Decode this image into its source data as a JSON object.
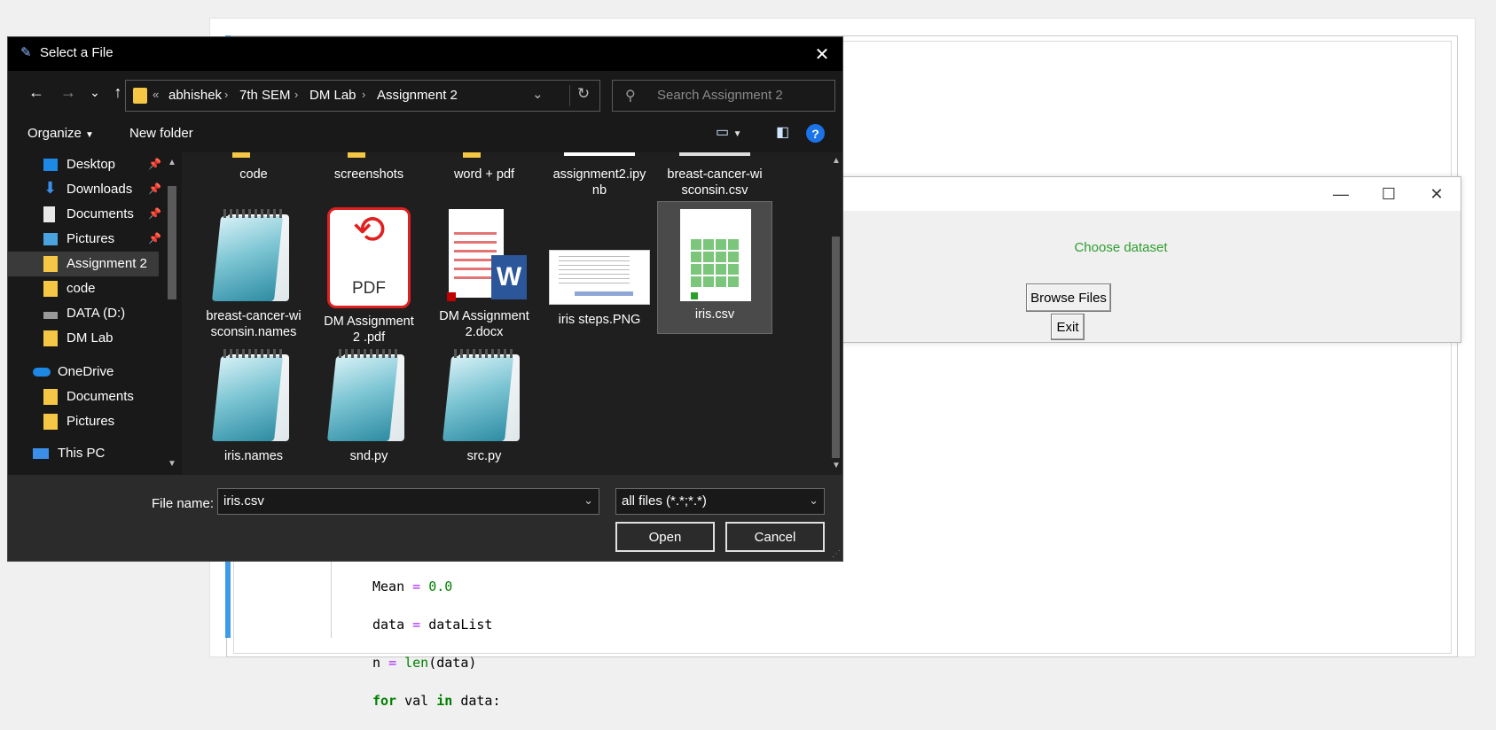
{
  "editor": {
    "code_lines": [
      {
        "a": "Mean ",
        "op": "=",
        "b": " ",
        "num": "0.0"
      },
      {
        "a": "data ",
        "op": "=",
        "b": " dataList"
      },
      {
        "a": "n ",
        "op": "=",
        "b": " ",
        "fn": "len",
        "c": "(data)"
      },
      {
        "kw1": "for",
        "a": " val ",
        "kw2": "in",
        "b": " data:"
      }
    ]
  },
  "tk_window": {
    "label": "Choose dataset",
    "label_color": "#2e9e2e",
    "browse_button": "Browse Files",
    "exit_button": "Exit",
    "minimize": "—",
    "maximize": "☐",
    "close": "✕"
  },
  "dialog": {
    "title": "Select a File",
    "close": "✕",
    "nav": {
      "back": "←",
      "forward": "→",
      "recent": "⌄",
      "up": "↑"
    },
    "breadcrumb": {
      "overflow": "«",
      "items": [
        "abhishek",
        "7th SEM",
        "DM Lab",
        "Assignment 2"
      ],
      "separator": "›",
      "refresh": "↻",
      "chevron": "⌄"
    },
    "search_placeholder": "Search Assignment 2",
    "toolbar": {
      "organize": "Organize",
      "new_folder": "New folder",
      "help": "?"
    },
    "nav_pane": [
      {
        "label": "Desktop",
        "icon": "desktop-icon",
        "pinned": true
      },
      {
        "label": "Downloads",
        "icon": "downloads-icon",
        "pinned": true
      },
      {
        "label": "Documents",
        "icon": "documents-icon",
        "pinned": true
      },
      {
        "label": "Pictures",
        "icon": "pictures-icon",
        "pinned": true
      },
      {
        "label": "Assignment 2",
        "icon": "folder-icon",
        "pinned": false,
        "selected": true
      },
      {
        "label": "code",
        "icon": "folder-icon",
        "pinned": false
      },
      {
        "label": "DATA (D:)",
        "icon": "drive-icon",
        "pinned": false
      },
      {
        "label": "DM Lab",
        "icon": "folder-icon",
        "pinned": false
      },
      {
        "label": "OneDrive",
        "icon": "onedrive-icon",
        "pinned": false
      },
      {
        "label": "Documents",
        "icon": "folder-icon",
        "pinned": false
      },
      {
        "label": "Pictures",
        "icon": "folder-icon",
        "pinned": false
      },
      {
        "label": "This PC",
        "icon": "pc-icon",
        "pinned": false
      }
    ],
    "files": [
      {
        "line1": "code",
        "line2": "",
        "type": "folder"
      },
      {
        "line1": "screenshots",
        "line2": "",
        "type": "folder"
      },
      {
        "line1": "word + pdf",
        "line2": "",
        "type": "folder"
      },
      {
        "line1": "assignment2.ipy",
        "line2": "nb",
        "type": "ipynb"
      },
      {
        "line1": "breast-cancer-wi",
        "line2": "sconsin.csv",
        "type": "csv"
      },
      {
        "line1": "breast-cancer-wi",
        "line2": "sconsin.names",
        "type": "text"
      },
      {
        "line1": "DM Assignment",
        "line2": "2 .pdf",
        "type": "pdf"
      },
      {
        "line1": "DM Assignment",
        "line2": "2.docx",
        "type": "docx"
      },
      {
        "line1": "iris steps.PNG",
        "line2": "",
        "type": "png"
      },
      {
        "line1": "iris.csv",
        "line2": "",
        "type": "csv",
        "selected": true
      },
      {
        "line1": "iris.names",
        "line2": "",
        "type": "text"
      },
      {
        "line1": "snd.py",
        "line2": "",
        "type": "text"
      },
      {
        "line1": "src.py",
        "line2": "",
        "type": "text"
      }
    ],
    "pdf_icon_text": "PDF",
    "word_badge": "W",
    "file_name_label": "File name:",
    "file_name_value": "iris.csv",
    "file_type_value": "all files (*.*;*.*)",
    "open_button": "Open",
    "cancel_button": "Cancel"
  }
}
